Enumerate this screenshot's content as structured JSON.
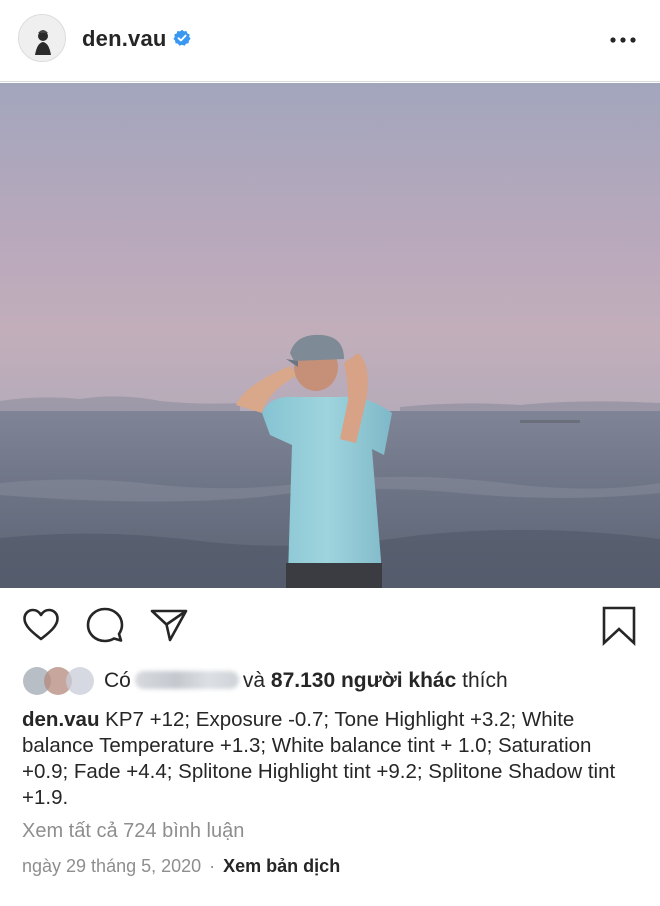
{
  "post": {
    "username": "den.vau",
    "verified_icon": "verified-badge-icon",
    "more_icon": "more-options-icon",
    "accent_color": "#3897f0"
  },
  "actions": {
    "like_icon": "heart-icon",
    "comment_icon": "comment-icon",
    "share_icon": "send-icon",
    "save_icon": "bookmark-icon"
  },
  "likes": {
    "prefix": "Có",
    "connector": "và",
    "count": "87.130",
    "others_text": "người khác",
    "suffix": "thích"
  },
  "caption": {
    "author": "den.vau",
    "text": "KP7 +12; Exposure -0.7; Tone Highlight +3.2; White balance Temperature +1.3; White balance tint + 1.0; Saturation +0.9; Fade +4.4; Splitone Highlight tint +9.2; Splitone Shadow tint +1.9."
  },
  "comments": {
    "view_all": "Xem tất cả 724 bình luận"
  },
  "meta": {
    "date": "ngày 29 tháng 5, 2020",
    "separator": "·",
    "translate": "Xem bản dịch"
  }
}
